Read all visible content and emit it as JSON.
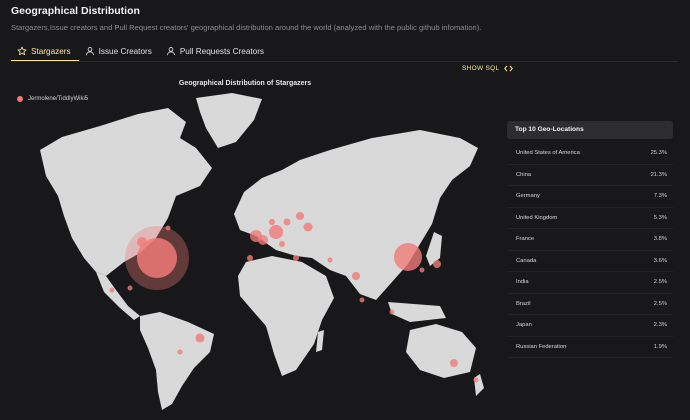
{
  "header": {
    "title": "Geographical Distribution",
    "subtitle": "Stargazers,Issue creators and Pull Request creators' geographical distribution around the world (analyzed with the public github infomation)."
  },
  "tabs": [
    {
      "label": "Stargazers",
      "icon": "star-icon",
      "active": true
    },
    {
      "label": "Issue Creators",
      "icon": "user-icon",
      "active": false
    },
    {
      "label": "Pull Requests Creators",
      "icon": "user-icon",
      "active": false
    }
  ],
  "show_sql": {
    "label": "SHOW SQL",
    "icon": "code-icon"
  },
  "chart": {
    "title": "Geographical Distribution of Stargazers",
    "legend_label": "Jermolene/TiddlyWiki5",
    "accent_color": "#ef7a78",
    "land_color": "#d9d9d9",
    "background_color": "#18181a"
  },
  "top_locations": {
    "title": "Top 10 Geo-Locations",
    "rows": [
      {
        "country": "United States of America",
        "percent": "25.3%"
      },
      {
        "country": "China",
        "percent": "21.3%"
      },
      {
        "country": "Germany",
        "percent": "7.3%"
      },
      {
        "country": "United Kingdom",
        "percent": "5.3%"
      },
      {
        "country": "France",
        "percent": "3.8%"
      },
      {
        "country": "Canada",
        "percent": "3.6%"
      },
      {
        "country": "India",
        "percent": "2.5%"
      },
      {
        "country": "Brazil",
        "percent": "2.5%"
      },
      {
        "country": "Japan",
        "percent": "2.3%"
      },
      {
        "country": "Russian Federation",
        "percent": "1.9%"
      }
    ]
  }
}
